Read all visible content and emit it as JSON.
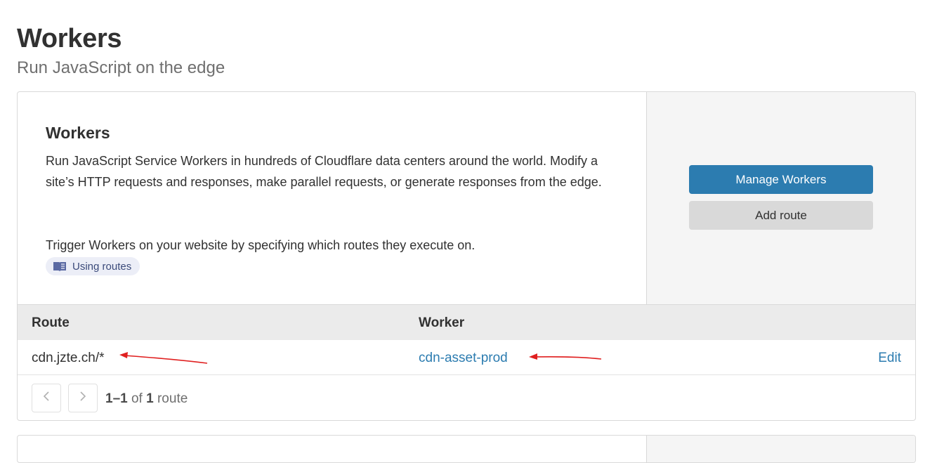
{
  "header": {
    "title": "Workers",
    "subtitle": "Run JavaScript on the edge"
  },
  "card": {
    "title": "Workers",
    "description": "Run JavaScript Service Workers in hundreds of Cloudflare data centers around the world. Modify a site’s HTTP requests and responses, make parallel requests, or generate responses from the edge.",
    "trigger_text": "Trigger Workers on your website by specifying which routes they execute on.",
    "doc_link_label": "Using routes",
    "doc_link_icon": "book-icon",
    "manage_button_label": "Manage Workers",
    "add_route_button_label": "Add route"
  },
  "table": {
    "columns": [
      "Route",
      "Worker"
    ],
    "rows": [
      {
        "route": "cdn.jzte.ch/*",
        "worker": "cdn-asset-prod",
        "action": "Edit"
      }
    ]
  },
  "pagination": {
    "range": "1–1",
    "of_label": "of",
    "total": "1",
    "unit": "route",
    "prev_icon": "chevron-left-icon",
    "next_icon": "chevron-right-icon"
  },
  "colors": {
    "primary": "#2c7cb0",
    "annotation_arrow": "#e02020",
    "side_panel": "#f5f5f5",
    "table_header": "#ebebeb"
  }
}
